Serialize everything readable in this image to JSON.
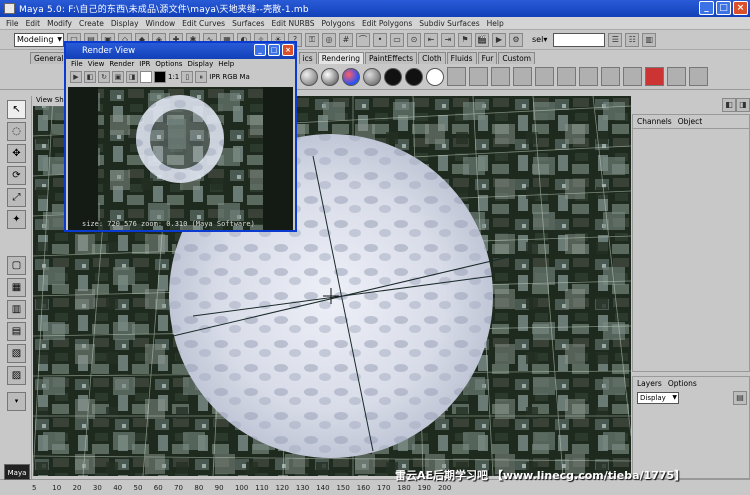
{
  "window": {
    "title": "Maya 5.0: F:\\自己的东西\\未成品\\源文件\\maya\\天地夹缝--壳散-1.mb"
  },
  "menubar": [
    "File",
    "Edit",
    "Modify",
    "Create",
    "Display",
    "Window",
    "Edit Curves",
    "Surfaces",
    "Edit NURBS",
    "Polygons",
    "Edit Polygons",
    "Subdiv Surfaces",
    "Help"
  ],
  "toolbar": {
    "mode_select": "Modeling",
    "sel_label": "sel▾"
  },
  "shelf_tabs": [
    "General",
    "ics",
    "Rendering",
    "PaintEffects",
    "Cloth",
    "Fluids",
    "Fur",
    "Custom"
  ],
  "active_shelf_tab": "Rendering",
  "viewport": {
    "menu": "View  Sh"
  },
  "render_view": {
    "title": "Render View",
    "menu": [
      "File",
      "View",
      "Render",
      "IPR",
      "Options",
      "Display",
      "Help"
    ],
    "tool_labels": {
      "ratio": "1:1",
      "ipr": "IPR",
      "rgb": "RGB",
      "map": "Ma"
    },
    "status": "size:  720  576  zoom: 0.310   (Maya Software)"
  },
  "channels_panel": {
    "tabs": [
      "Channels",
      "Object"
    ]
  },
  "layers_panel": {
    "tabs": [
      "Layers",
      "Options"
    ],
    "display_select": "Display"
  },
  "timeline": {
    "ticks": [
      "5",
      "10",
      "20",
      "30",
      "40",
      "50",
      "60",
      "70",
      "80",
      "90",
      "100",
      "110",
      "120",
      "130",
      "140",
      "150",
      "160",
      "170",
      "180",
      "190",
      "200"
    ]
  },
  "logo": "Maya",
  "watermark": "雷云AE后期学习吧 【www.linecg.com/tieba/1775】",
  "colors": {
    "titlebar": "#1a4ac8",
    "sphere_white": "#e6e8f0",
    "grid_line": "#c8d8c8"
  }
}
